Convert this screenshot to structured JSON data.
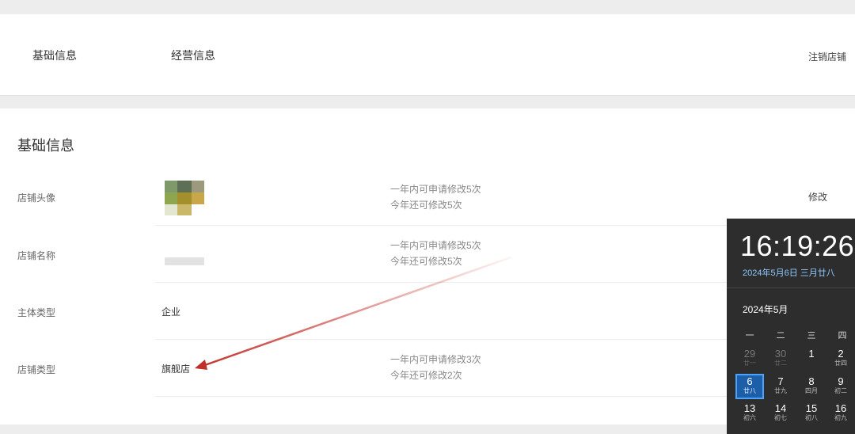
{
  "top_nav": {
    "tabs": [
      "基础信息",
      "经营信息"
    ],
    "cancel_store": "注销店铺"
  },
  "section_title": "基础信息",
  "rows": [
    {
      "label": "店铺头像",
      "value": "",
      "note_line1": "一年内可申请修改5次",
      "note_line2": "今年还可修改5次",
      "action": "修改"
    },
    {
      "label": "店铺名称",
      "value": "",
      "note_line1": "一年内可申请修改5次",
      "note_line2": "今年还可修改5次"
    },
    {
      "label": "主体类型",
      "value": "企业"
    },
    {
      "label": "店铺类型",
      "value": "旗舰店",
      "note_line1": "一年内可申请修改3次",
      "note_line2": "今年还可修改2次"
    }
  ],
  "annotation": {
    "arrow_color": "#c0302a"
  },
  "calendar": {
    "time": "16:19:26",
    "date_line": "2024年5月6日 三月廿八",
    "month_title": "2024年5月",
    "weekdays": [
      "一",
      "二",
      "三",
      "四"
    ],
    "week1": [
      {
        "day": "29",
        "lunar": "廿一"
      },
      {
        "day": "30",
        "lunar": "廿二"
      },
      {
        "day": "1",
        "lunar": ""
      },
      {
        "day": "2",
        "lunar": "廿四"
      }
    ],
    "week2": [
      {
        "day": "6",
        "lunar": "廿八"
      },
      {
        "day": "7",
        "lunar": "廿九"
      },
      {
        "day": "8",
        "lunar": "四月"
      },
      {
        "day": "9",
        "lunar": "初二"
      }
    ],
    "week3": [
      {
        "day": "13",
        "lunar": "初六"
      },
      {
        "day": "14",
        "lunar": "初七"
      },
      {
        "day": "15",
        "lunar": "初八"
      },
      {
        "day": "16",
        "lunar": "初九"
      }
    ],
    "accent_color": "#1c5fa8"
  }
}
